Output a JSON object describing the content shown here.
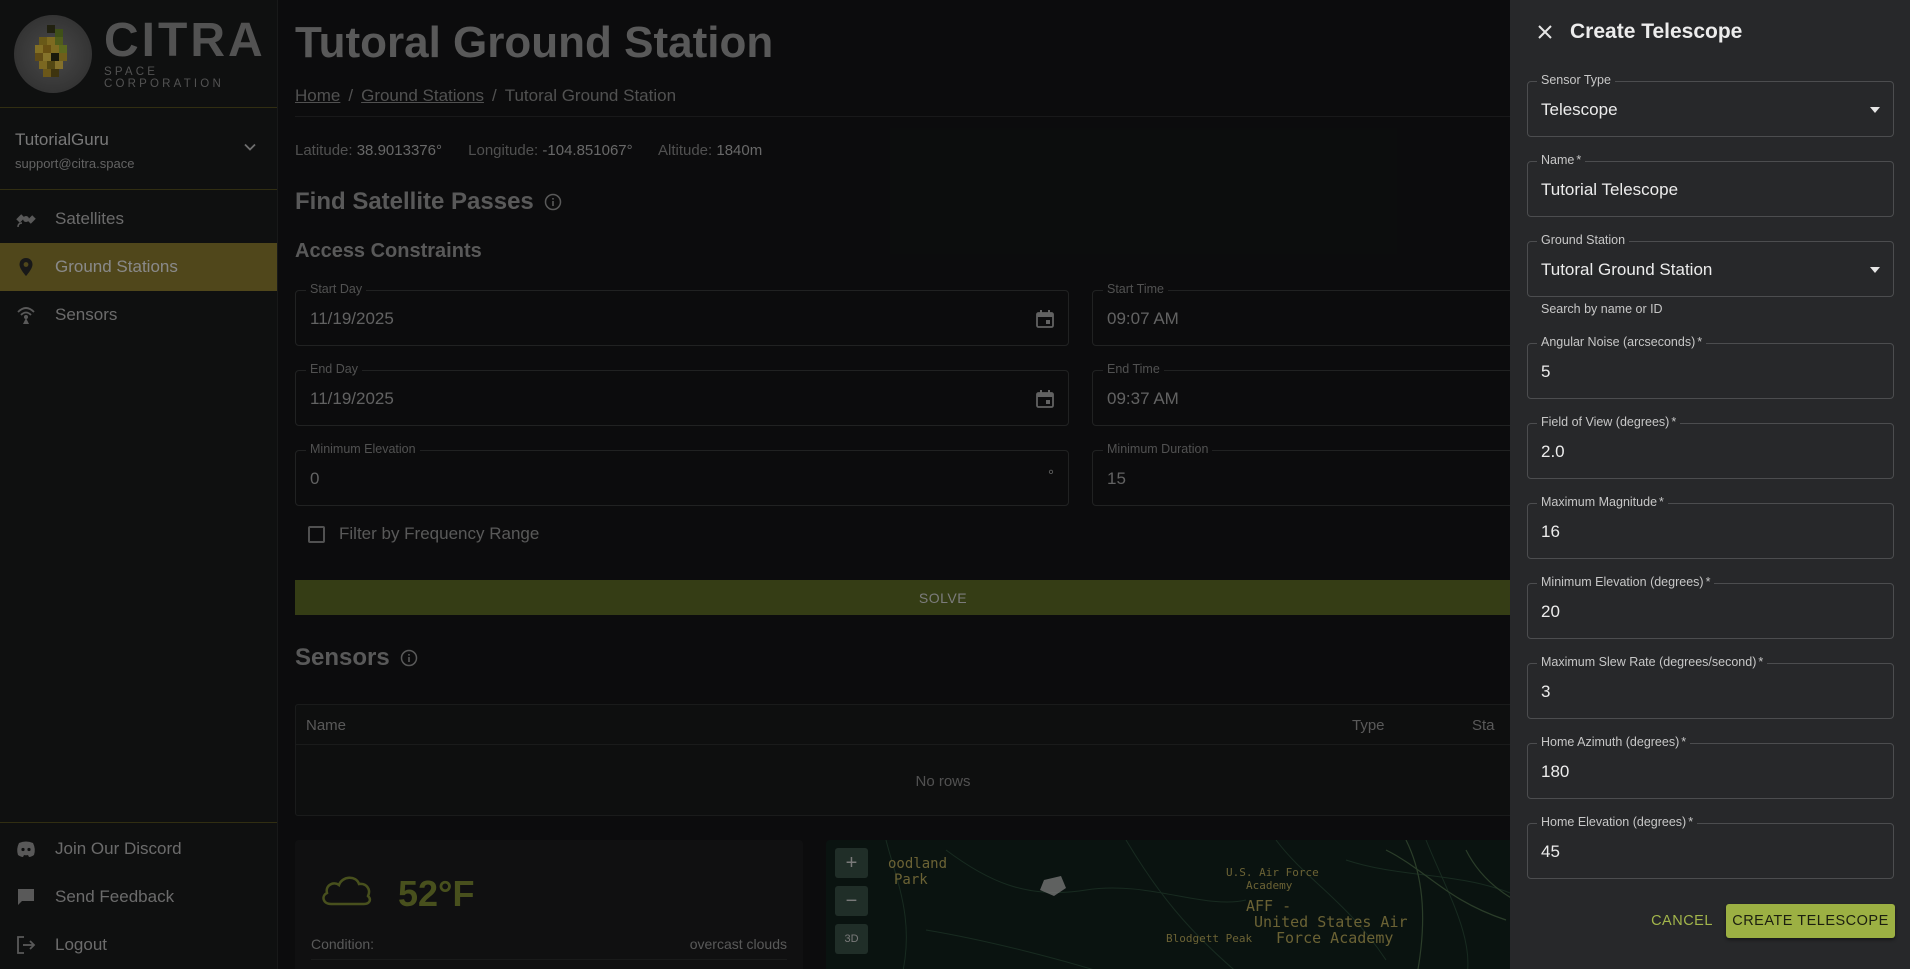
{
  "brand": {
    "name": "CITRA",
    "tagline": "SPACE CORPORATION"
  },
  "user": {
    "name": "TutorialGuru",
    "email": "support@citra.space"
  },
  "nav": {
    "items": [
      {
        "label": "Satellites",
        "icon": "satellite-icon",
        "active": false
      },
      {
        "label": "Ground Stations",
        "icon": "map-pin-icon",
        "active": true
      },
      {
        "label": "Sensors",
        "icon": "antenna-icon",
        "active": false
      }
    ],
    "bottom": [
      {
        "label": "Join Our Discord",
        "icon": "discord-icon"
      },
      {
        "label": "Send Feedback",
        "icon": "chat-icon"
      },
      {
        "label": "Logout",
        "icon": "logout-icon"
      }
    ]
  },
  "page": {
    "title": "Tutoral Ground Station",
    "breadcrumb": [
      "Home",
      "Ground Stations",
      "Tutoral Ground Station"
    ],
    "coords": {
      "lat_label": "Latitude:",
      "lat": "38.9013376°",
      "lon_label": "Longitude:",
      "lon": "-104.851067°",
      "alt_label": "Altitude:",
      "alt": "1840m"
    }
  },
  "passes": {
    "title": "Find Satellite Passes",
    "constraints_title": "Access Constraints",
    "start_day": {
      "label": "Start Day",
      "value": "11/19/2025"
    },
    "start_time": {
      "label": "Start Time",
      "value": "09:07 AM"
    },
    "end_day": {
      "label": "End Day",
      "value": "11/19/2025"
    },
    "end_time": {
      "label": "End Time",
      "value": "09:37 AM"
    },
    "min_elevation": {
      "label": "Minimum Elevation",
      "value": "0",
      "unit": "°"
    },
    "min_duration": {
      "label": "Minimum Duration",
      "value": "15"
    },
    "filter_freq": "Filter by Frequency Range",
    "solve": "SOLVE"
  },
  "sensors": {
    "title": "Sensors",
    "columns": [
      "Name",
      "Type",
      "Sta"
    ],
    "empty": "No rows"
  },
  "weather": {
    "temp": "52°F",
    "condition_label": "Condition:",
    "condition": "overcast clouds"
  },
  "map": {
    "zoom_in": "+",
    "zoom_out": "−",
    "mode_3d": "3D",
    "labels": [
      "oodland",
      "Park",
      "U.S. Air Force",
      "Academy",
      "AFF -",
      "United States Air",
      "Force Academy",
      "Blodgett Peak"
    ]
  },
  "drawer": {
    "title": "Create Telescope",
    "fields": [
      {
        "label": "Sensor Type",
        "value": "Telescope",
        "select": true,
        "required": false
      },
      {
        "label": "Name",
        "value": "Tutorial Telescope",
        "select": false,
        "required": true
      },
      {
        "label": "Ground Station",
        "value": "Tutoral Ground Station",
        "select": true,
        "required": false
      },
      {
        "label": "Angular Noise (arcseconds)",
        "value": "5",
        "select": false,
        "required": true
      },
      {
        "label": "Field of View (degrees)",
        "value": "2.0",
        "select": false,
        "required": true
      },
      {
        "label": "Maximum Magnitude",
        "value": "16",
        "select": false,
        "required": true
      },
      {
        "label": "Minimum Elevation (degrees)",
        "value": "20",
        "select": false,
        "required": true
      },
      {
        "label": "Maximum Slew Rate (degrees/second)",
        "value": "3",
        "select": false,
        "required": true
      },
      {
        "label": "Home Azimuth (degrees)",
        "value": "180",
        "select": false,
        "required": true
      },
      {
        "label": "Home Elevation (degrees)",
        "value": "45",
        "select": false,
        "required": true
      }
    ],
    "ground_station_helper": "Search by name or ID",
    "required_mark": "*",
    "cancel": "CANCEL",
    "create": "CREATE TELESCOPE"
  },
  "colors": {
    "accent": "#9cb043",
    "nav_active": "#8a7a30",
    "solve": "#5c6a25"
  }
}
